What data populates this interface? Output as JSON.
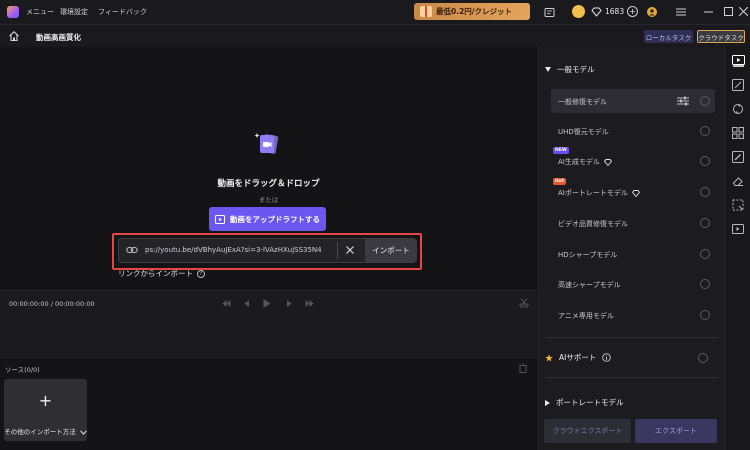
{
  "titlebar": {
    "menu": [
      "メニュー",
      "環境設定",
      "フィードバック"
    ],
    "promo": "最低0.2円/クレジット",
    "credits": "1683"
  },
  "header": {
    "title": "動画高画質化",
    "local_task": "ローカルタスク",
    "cloud_task": "クラウドタスク"
  },
  "droparea": {
    "drag_title": "動画をドラッグ＆ドロップ",
    "or_small": "または",
    "upload_button": "動画をアップドラフトする",
    "or_divider": "または",
    "link_label": "リンクからインポート",
    "help_glyph": "?",
    "url_value": "ps://youtu.be/dVBhyAuJExA?si=3-lVAzHXujSS35N4",
    "import_button": "インポート"
  },
  "timeline": {
    "timecode": "00:00:00:00 / 00:00:00:00"
  },
  "source": {
    "label": "ソース(0/0)",
    "card_plus": "+",
    "card_label": "その他のインポート方法"
  },
  "models": {
    "general_header": "一般モデル",
    "items": [
      {
        "label": "一般修復モデル",
        "badge": ""
      },
      {
        "label": "UHD復元モデル",
        "badge": ""
      },
      {
        "label": "AI生成モデル",
        "badge": "NEW"
      },
      {
        "label": "AIポートレートモデル",
        "badge": "Hot"
      },
      {
        "label": "ビデオ品質修復モデル",
        "badge": ""
      },
      {
        "label": "HDシャープモデル",
        "badge": ""
      },
      {
        "label": "高速シャープモデル",
        "badge": ""
      },
      {
        "label": "アニメ専用モデル",
        "badge": ""
      }
    ],
    "ai_support": "AIサポート",
    "portrait_header": "ポートレートモデル",
    "cloud_export": "クラウドエクスポート",
    "export": "エクスポート"
  },
  "colors": {
    "accent": "#6c56f2",
    "highlight_outline": "#e84646",
    "promo": "#e3a45a"
  }
}
